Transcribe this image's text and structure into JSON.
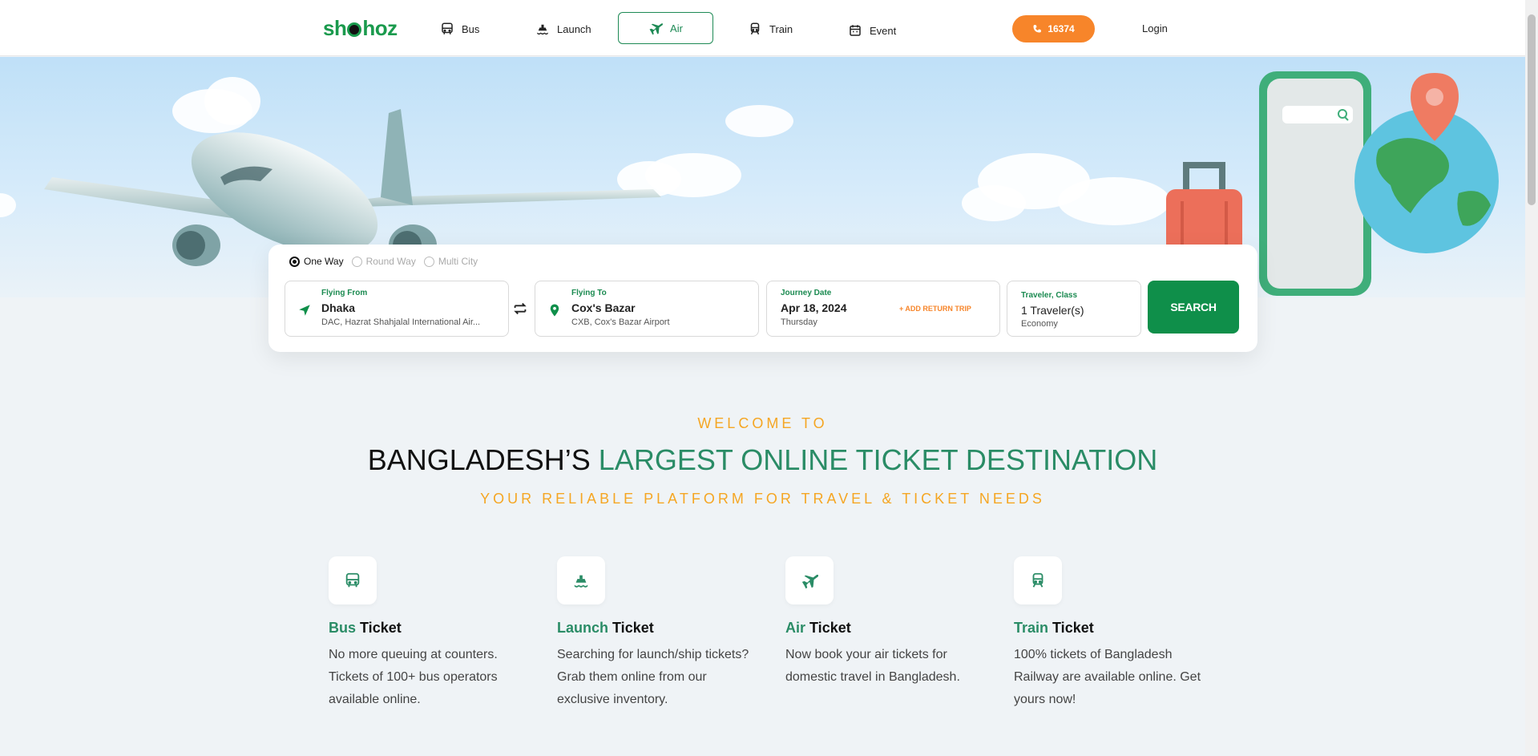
{
  "header": {
    "logo": {
      "pre": "sh",
      "post": "hoz"
    },
    "nav": [
      {
        "label": "Bus",
        "icon": "bus-icon"
      },
      {
        "label": "Launch",
        "icon": "launch-icon"
      },
      {
        "label": "Air",
        "icon": "plane-icon"
      },
      {
        "label": "Train",
        "icon": "train-icon"
      },
      {
        "label": "Event",
        "icon": "calendar-icon"
      }
    ],
    "phone": "16374",
    "login": "Login"
  },
  "search": {
    "trip_types": [
      "One Way",
      "Round Way",
      "Multi City"
    ],
    "selected_trip": "One Way",
    "from": {
      "label": "Flying From",
      "city": "Dhaka",
      "airport": "DAC, Hazrat Shahjalal International Air..."
    },
    "to": {
      "label": "Flying To",
      "city": "Cox's Bazar",
      "airport": "CXB, Cox's Bazar Airport"
    },
    "date": {
      "label": "Journey Date",
      "value": "Apr 18, 2024",
      "day": "Thursday",
      "return_link": "+ ADD RETURN TRIP"
    },
    "traveler": {
      "label": "Traveler, Class",
      "value": "1 Traveler(s)",
      "class": "Economy"
    },
    "button": "SEARCH"
  },
  "welcome": {
    "line1": "WELCOME TO",
    "line2_a": "BANGLADESH’S ",
    "line2_b": "LARGEST ONLINE TICKET DESTINATION",
    "line3": "YOUR RELIABLE PLATFORM FOR TRAVEL & TICKET NEEDS"
  },
  "services": [
    {
      "name": "Bus",
      "suffix": " Ticket",
      "desc": "No more queuing at counters. Tickets of 100+ bus operators available online.",
      "icon": "bus-icon"
    },
    {
      "name": "Launch",
      "suffix": " Ticket",
      "desc": "Searching for launch/ship tickets? Grab them online from our exclusive inventory.",
      "icon": "launch-icon"
    },
    {
      "name": "Air",
      "suffix": " Ticket",
      "desc": "Now book your air tickets for domestic travel in Bangladesh.",
      "icon": "plane-icon"
    },
    {
      "name": "Train",
      "suffix": " Ticket",
      "desc": "100% tickets of Bangladesh Railway are available online. Get yours now!",
      "icon": "train-icon"
    }
  ],
  "colors": {
    "brand_green": "#1a9a4d",
    "accent_orange": "#f7852a",
    "heading_green": "#2a8c66"
  }
}
